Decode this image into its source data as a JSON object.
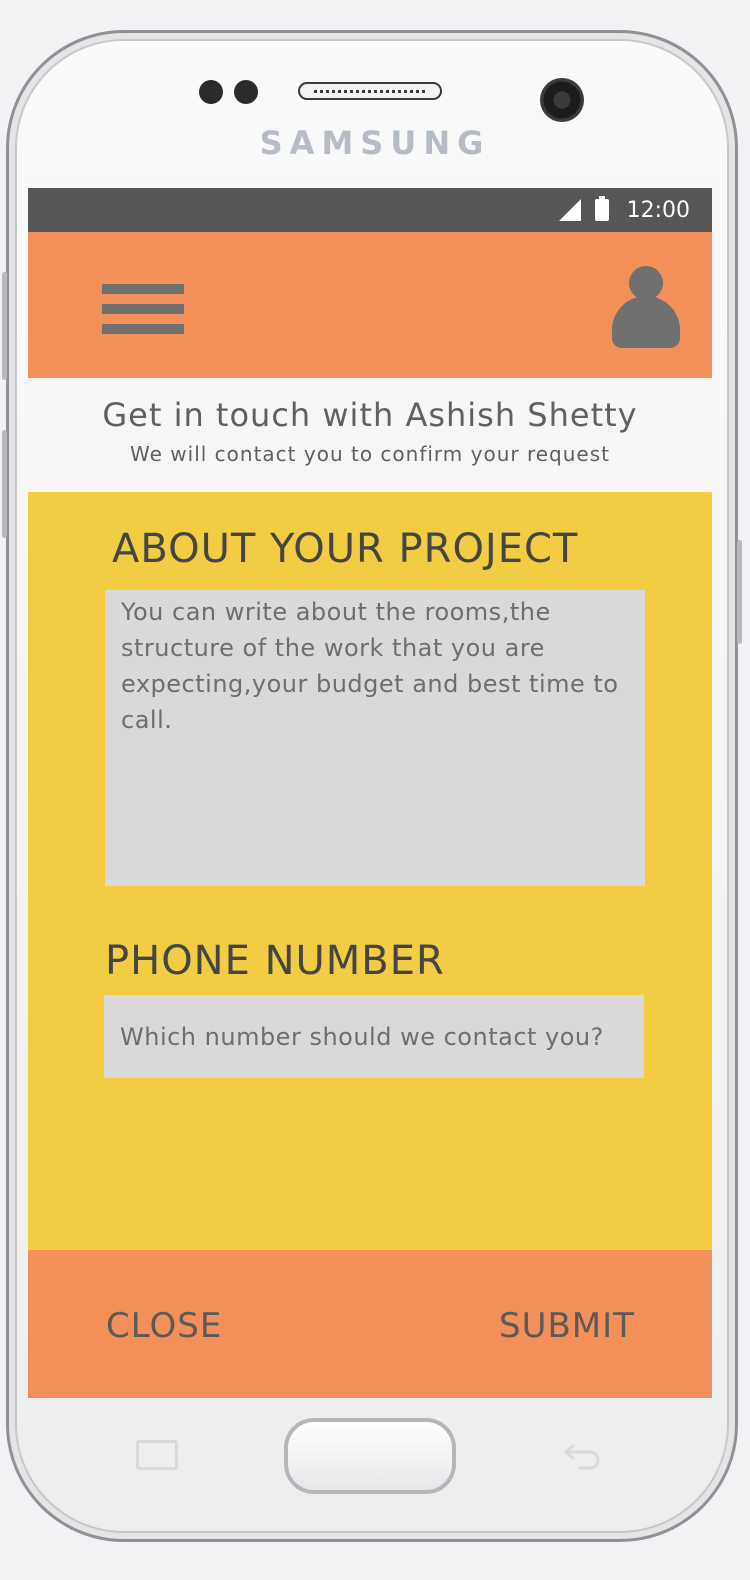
{
  "device": {
    "brand": "SAMSUNG"
  },
  "status_bar": {
    "time": "12:00",
    "signal_icon": "signal-icon",
    "battery_icon": "battery-icon"
  },
  "app_bar": {
    "menu_icon": "hamburger-menu-icon",
    "profile_icon": "user-avatar-icon",
    "color": "#f38f58"
  },
  "header": {
    "title": "Get in touch with Ashish Shetty",
    "subtitle": "We will contact you to confirm your request"
  },
  "form": {
    "project_label": "ABOUT YOUR PROJECT",
    "project_placeholder": "You can write about the rooms,the structure of the work that you are expecting,your budget and best time to call.",
    "phone_label": "PHONE NUMBER",
    "phone_placeholder": "Which number should we contact you?",
    "background_color": "#f2cd44"
  },
  "footer": {
    "close_label": "CLOSE",
    "submit_label": "SUBMIT"
  }
}
